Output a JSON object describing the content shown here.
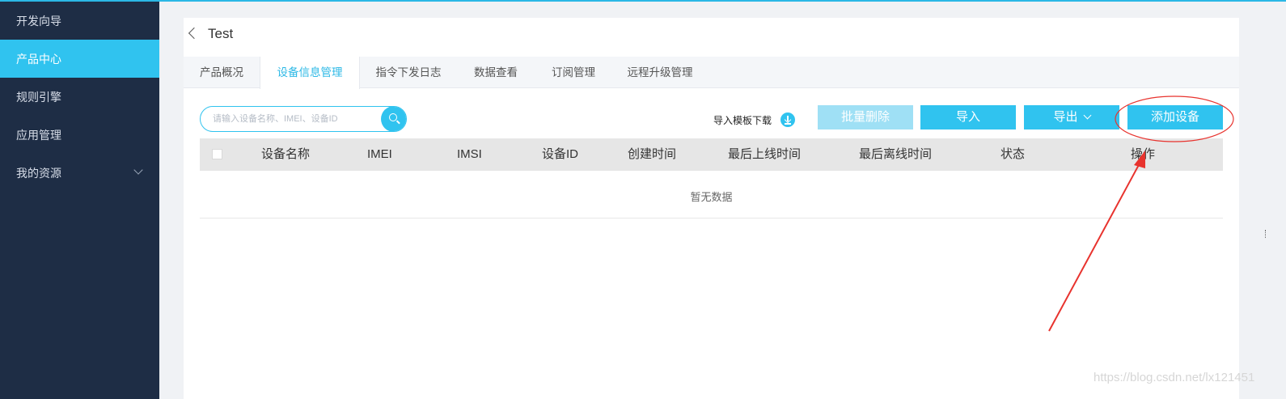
{
  "sidebar": {
    "items": [
      {
        "label": "开发向导"
      },
      {
        "label": "产品中心"
      },
      {
        "label": "规则引擎"
      },
      {
        "label": "应用管理"
      },
      {
        "label": "我的资源"
      }
    ]
  },
  "header": {
    "title": "Test"
  },
  "tabs": [
    {
      "label": "产品概况"
    },
    {
      "label": "设备信息管理"
    },
    {
      "label": "指令下发日志"
    },
    {
      "label": "数据查看"
    },
    {
      "label": "订阅管理"
    },
    {
      "label": "远程升级管理"
    }
  ],
  "toolbar": {
    "search_placeholder": "请输入设备名称、IMEI、设备ID",
    "template_download": "导入模板下载",
    "batch_delete": "批量删除",
    "import": "导入",
    "export": "导出",
    "add_device": "添加设备"
  },
  "table": {
    "columns": [
      "设备名称",
      "IMEI",
      "IMSI",
      "设备ID",
      "创建时间",
      "最后上线时间",
      "最后离线时间",
      "状态",
      "操作"
    ],
    "empty_text": "暂无数据"
  },
  "watermark": "https://blog.csdn.net/lx121451",
  "colors": {
    "accent": "#30c3ef",
    "sidebar": "#1e2d45",
    "annotation": "#e8332e"
  }
}
